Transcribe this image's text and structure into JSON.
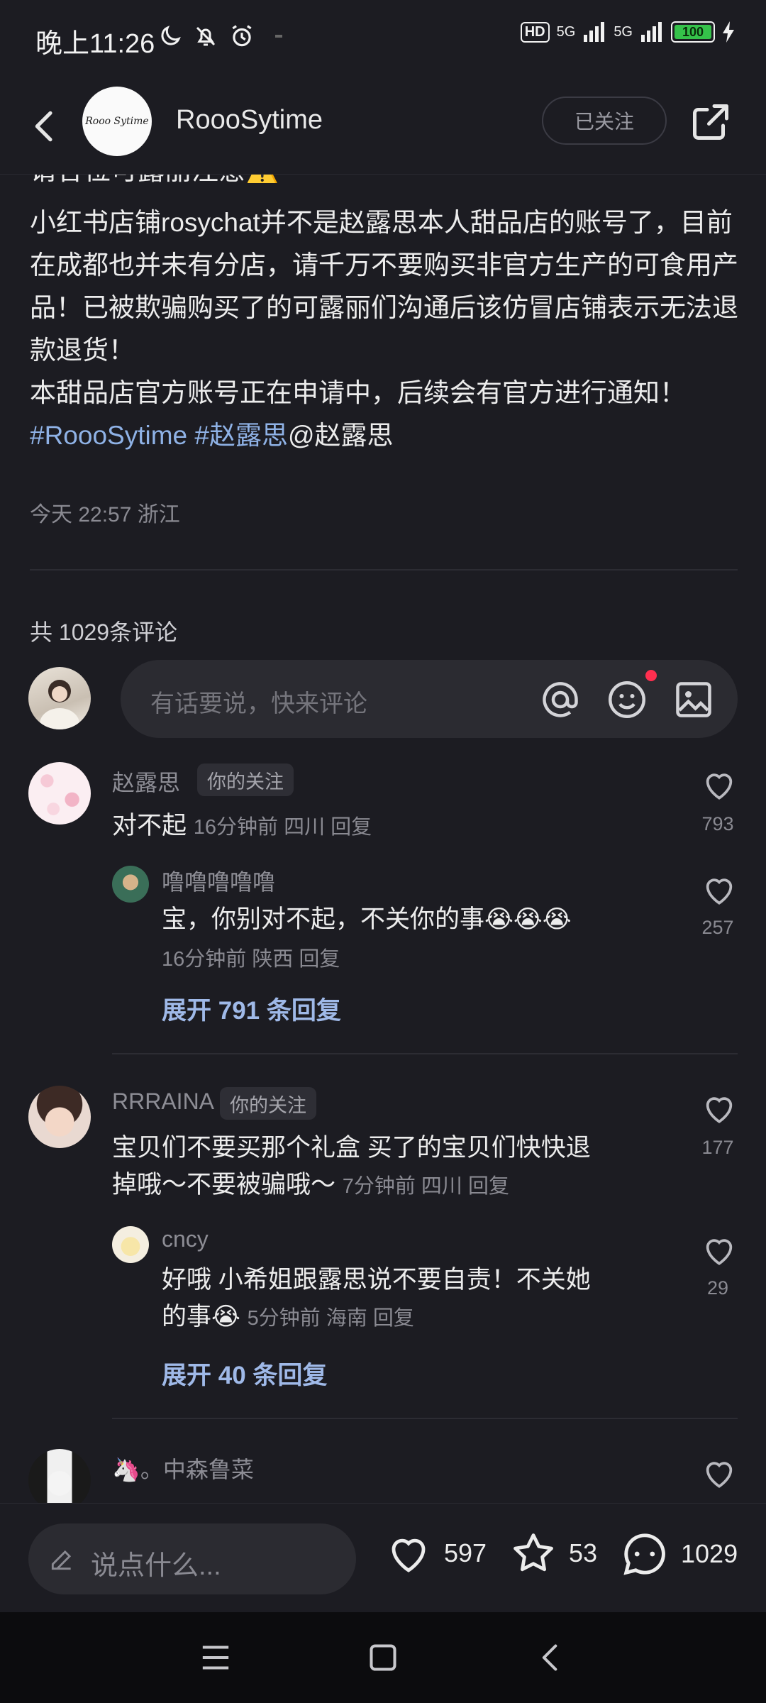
{
  "status_bar": {
    "time": "晚上11:26",
    "hd": "HD",
    "net1": "5G",
    "net2": "5G",
    "battery": "100"
  },
  "header": {
    "author_name": "RoooSytime",
    "avatar_text": "Rooo Sytime",
    "follow_label": "已关注"
  },
  "post": {
    "cut_line": "请各位可露丽注意⚠️",
    "body": "小红书店铺rosychat并不是赵露思本人甜品店的账号了，目前在成都也并未有分店，请千万不要购买非官方生产的可食用产品！已被欺骗购买了的可露丽们沟通后该仿冒店铺表示无法退款退货！\n本甜品店官方账号正在申请中，后续会有官方进行通知！",
    "tag1": "#RoooSytime",
    "tag2": "#赵露思",
    "mention": "@赵露思",
    "meta": "今天 22:57 浙江"
  },
  "comments_section": {
    "count_label": "共 1029条评论",
    "input_placeholder": "有话要说，快来评论"
  },
  "comments": [
    {
      "name": "赵露思",
      "badge": "你的关注",
      "text": "对不起",
      "meta": "16分钟前  四川  回复",
      "likes": "793",
      "reply": {
        "name": "噜噜噜噜噜",
        "text": "宝，你别对不起，不关你的事😭😭😭",
        "meta": "16分钟前  陕西  回复",
        "likes": "257"
      },
      "expand": "展开 791 条回复"
    },
    {
      "name": "RRRAINA",
      "badge": "你的关注",
      "text_line1": "宝贝们不要买那个礼盒 买了的宝贝们快快退",
      "text_line2": "掉哦～不要被骗哦～",
      "meta": "7分钟前  四川  回复",
      "likes": "177",
      "reply": {
        "name": "cncy",
        "text_line1": "好哦 小希姐跟露思说不要自责！不关她",
        "text_line2": "的事😭",
        "meta": "5分钟前  海南  回复",
        "likes": "29"
      },
      "expand": "展开 40 条回复"
    },
    {
      "name": "🦄。中森鲁菜"
    }
  ],
  "bottom_bar": {
    "input_placeholder": "说点什么...",
    "likes": "597",
    "favorites": "53",
    "comments": "1029"
  },
  "colors": {
    "background": "#1c1c22",
    "link": "#8fb2e6",
    "expand": "#9fb9e8",
    "muted": "#8a8a92",
    "notify_dot": "#ff2f4f",
    "battery": "#35c24a"
  }
}
